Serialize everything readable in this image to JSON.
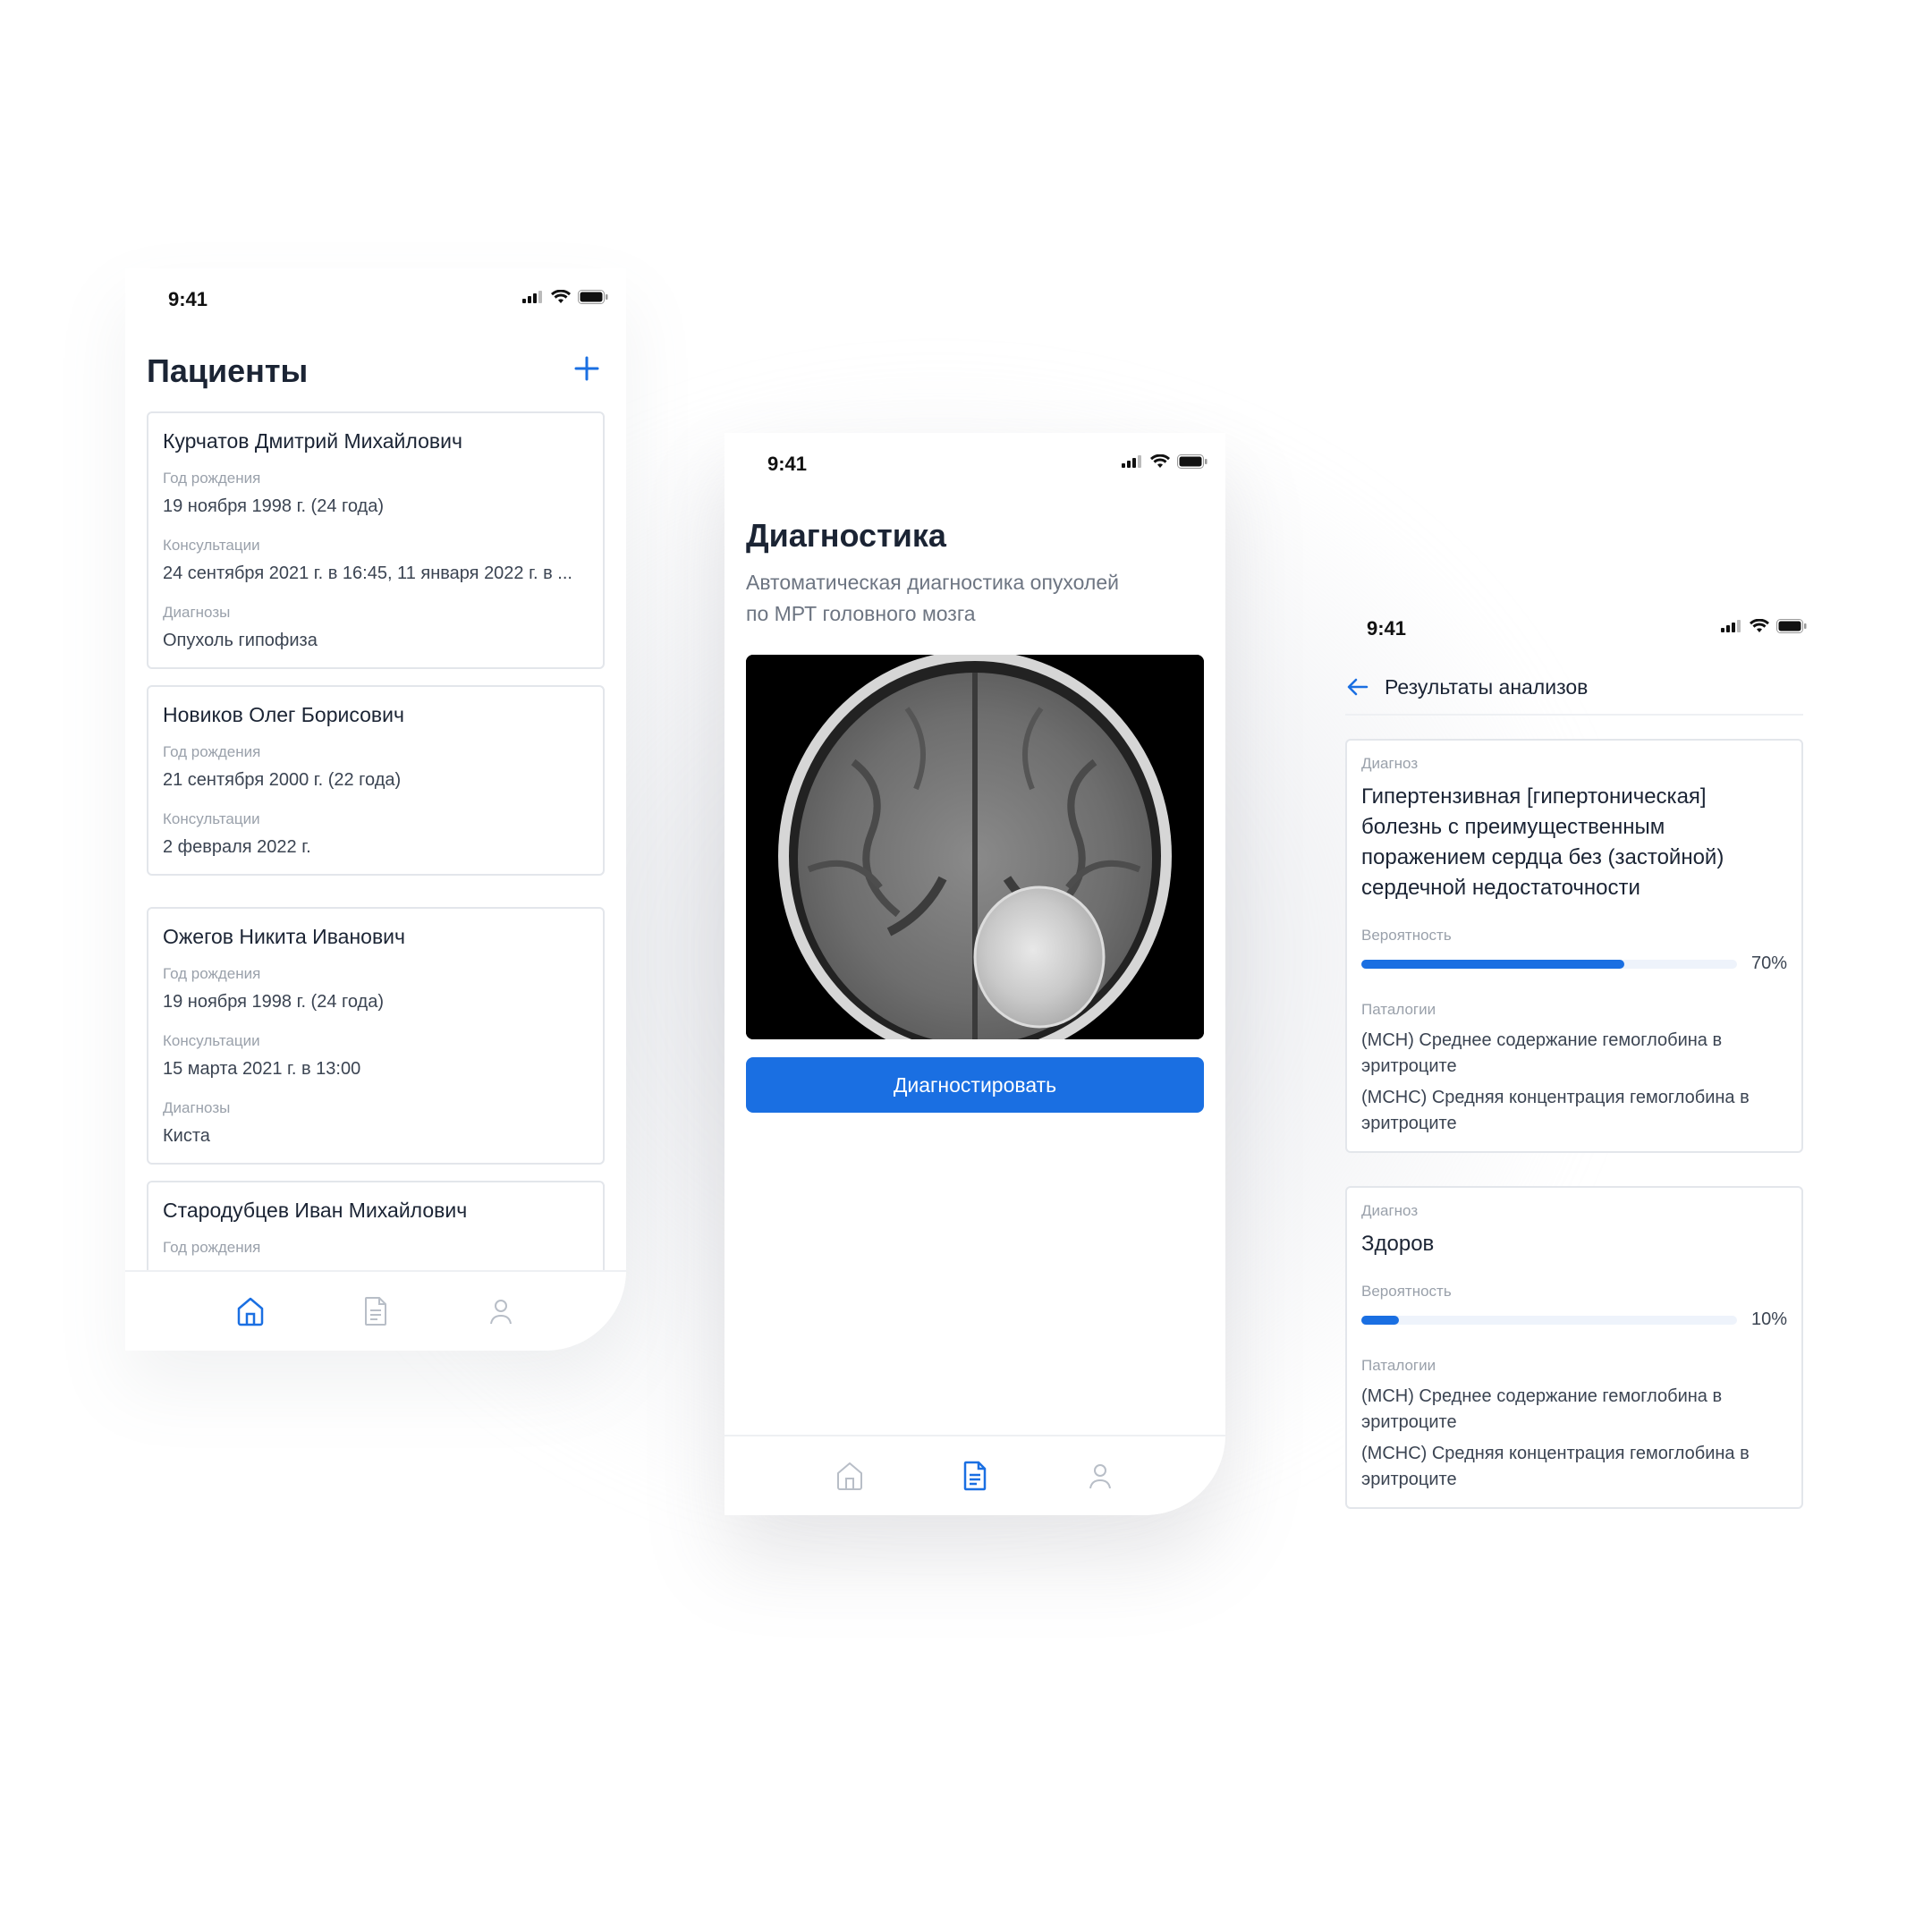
{
  "status_time": "9:41",
  "accent_color": "#1a6fe2",
  "patients_screen": {
    "title": "Пациенты",
    "add_icon": "plus-icon",
    "patients": [
      {
        "name": "Курчатов Дмитрий Михайлович",
        "birth_label": "Год рождения",
        "birth": "19 ноября 1998 г. (24 года)",
        "consult_label": "Консультации",
        "consult": "24 сентября 2021 г. в 16:45, 11 января 2022 г. в ...",
        "diag_label": "Диагнозы",
        "diag": "Опухоль гипофиза"
      },
      {
        "name": "Новиков Олег Борисович",
        "birth_label": "Год рождения",
        "birth": "21 сентября 2000 г. (22 года)",
        "consult_label": "Консультации",
        "consult": "2 февраля 2022 г."
      },
      {
        "name": "Ожегов Никита Иванович",
        "birth_label": "Год рождения",
        "birth": "19 ноября 1998 г. (24 года)",
        "consult_label": "Консультации",
        "consult": "15 марта 2021 г. в 13:00",
        "diag_label": "Диагнозы",
        "diag": "Киста"
      },
      {
        "name": "Стародубцев Иван Михайлович",
        "birth_label": "Год рождения"
      }
    ],
    "active_tab": "home"
  },
  "diagnostics_screen": {
    "title": "Диагностика",
    "subtitle": "Автоматическая диагностика опухолей по МРТ головного мозга",
    "image_alt": "mri-brain-scan",
    "button_label": "Диагностировать",
    "active_tab": "documents"
  },
  "results_screen": {
    "header_title": "Результаты анализов",
    "results": [
      {
        "diag_label": "Диагноз",
        "diagnosis": "Гипертензивная [гипертоническая] болезнь с преимущественным поражением сердца без (застойной) сердечной недостаточности",
        "prob_label": "Вероятность",
        "probability": 0.7,
        "probability_text": "70%",
        "path_label": "Паталогии",
        "pathologies": [
          "(МСН) Среднее содержание гемоглобина в эритроците",
          "(МСНС) Средняя концентрация гемоглобина в эритроците"
        ]
      },
      {
        "diag_label": "Диагноз",
        "diagnosis": "Здоров",
        "prob_label": "Вероятность",
        "probability": 0.1,
        "probability_text": "10%",
        "path_label": "Паталогии",
        "pathologies": [
          "(МСН) Среднее содержание гемоглобина в эритроците",
          "(МСНС) Средняя концентрация гемоглобина в эритроците"
        ]
      }
    ]
  }
}
